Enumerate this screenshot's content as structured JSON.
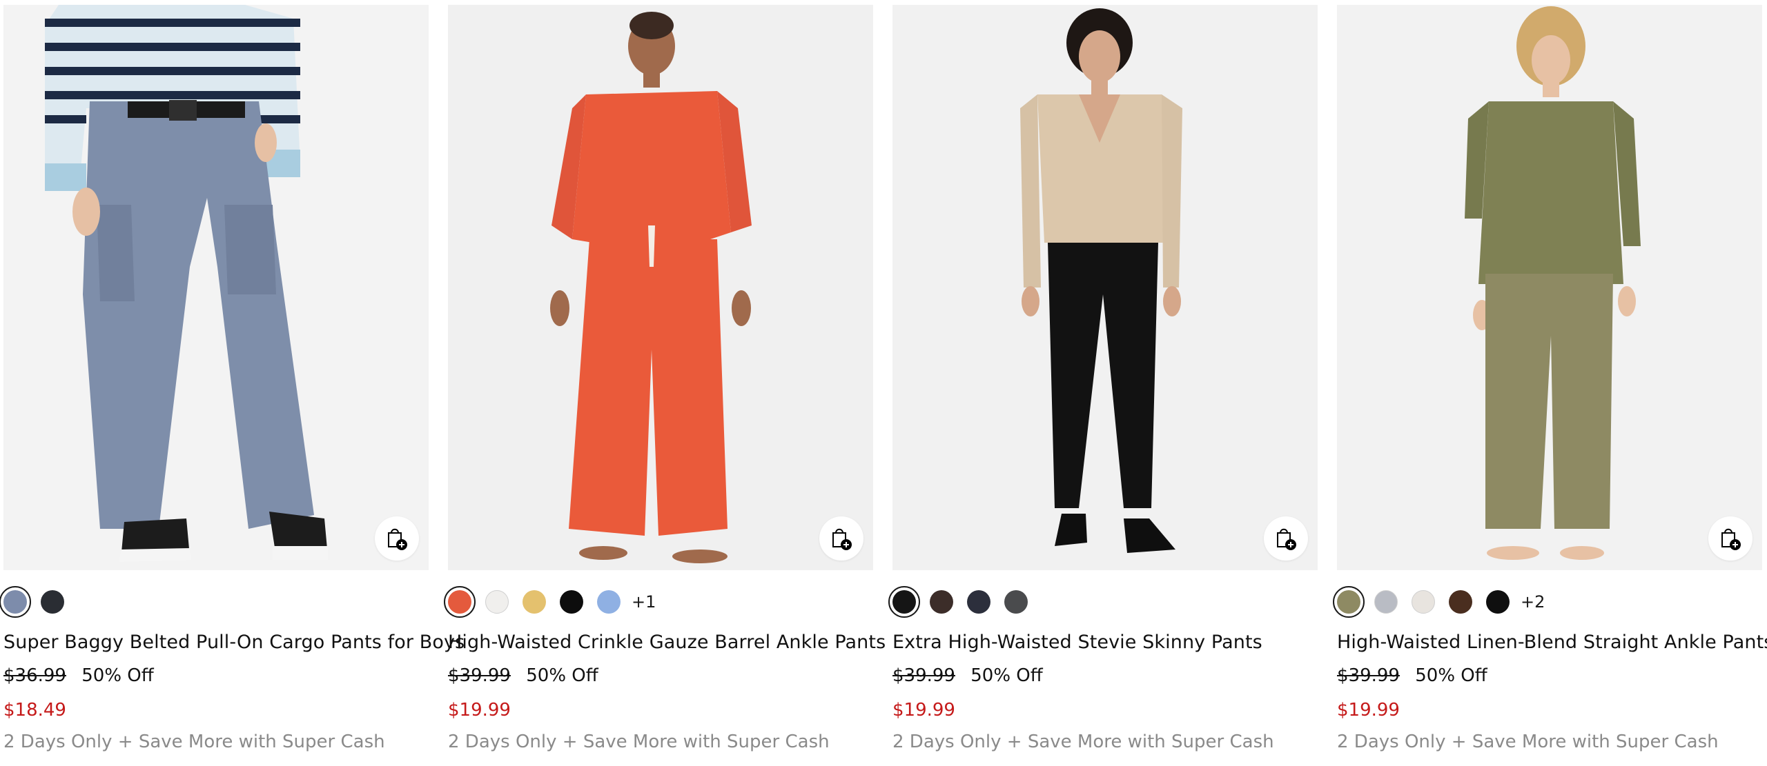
{
  "products": [
    {
      "title": "Super Baggy Belted Pull-On Cargo Pants for Boys",
      "original_price": "$36.99",
      "discount": "50% Off",
      "sale_price": "$18.49",
      "promo": "2 Days Only + Save More with Super Cash",
      "swatches": [
        "#7d8cab",
        "#2a2d33"
      ],
      "more_colors": "",
      "image_icon": "product-photo"
    },
    {
      "title": "High-Waisted Crinkle Gauze Barrel Ankle Pants",
      "original_price": "$39.99",
      "discount": "50% Off",
      "sale_price": "$19.99",
      "promo": "2 Days Only + Save More with Super Cash",
      "swatches": [
        "#e45a3d",
        "#f0efed",
        "#e4c16e",
        "#0d0d0d",
        "#8fb0e3"
      ],
      "more_colors": "+1",
      "image_icon": "product-photo"
    },
    {
      "title": "Extra High-Waisted Stevie Skinny Pants",
      "original_price": "$39.99",
      "discount": "50% Off",
      "sale_price": "$19.99",
      "promo": "2 Days Only + Save More with Super Cash",
      "swatches": [
        "#151515",
        "#3c2d29",
        "#2c2f3c",
        "#4a4b4d"
      ],
      "more_colors": "",
      "image_icon": "product-photo"
    },
    {
      "title": "High-Waisted Linen-Blend Straight Ankle Pants",
      "original_price": "$39.99",
      "discount": "50% Off",
      "sale_price": "$19.99",
      "promo": "2 Days Only + Save More with Super Cash",
      "swatches": [
        "#8e8a63",
        "#b9bcc4",
        "#e8e4df",
        "#4a2e1f",
        "#0f0f0f"
      ],
      "more_colors": "+2",
      "image_icon": "product-photo"
    }
  ],
  "icons": {
    "add_to_bag": "add-to-bag-icon"
  }
}
